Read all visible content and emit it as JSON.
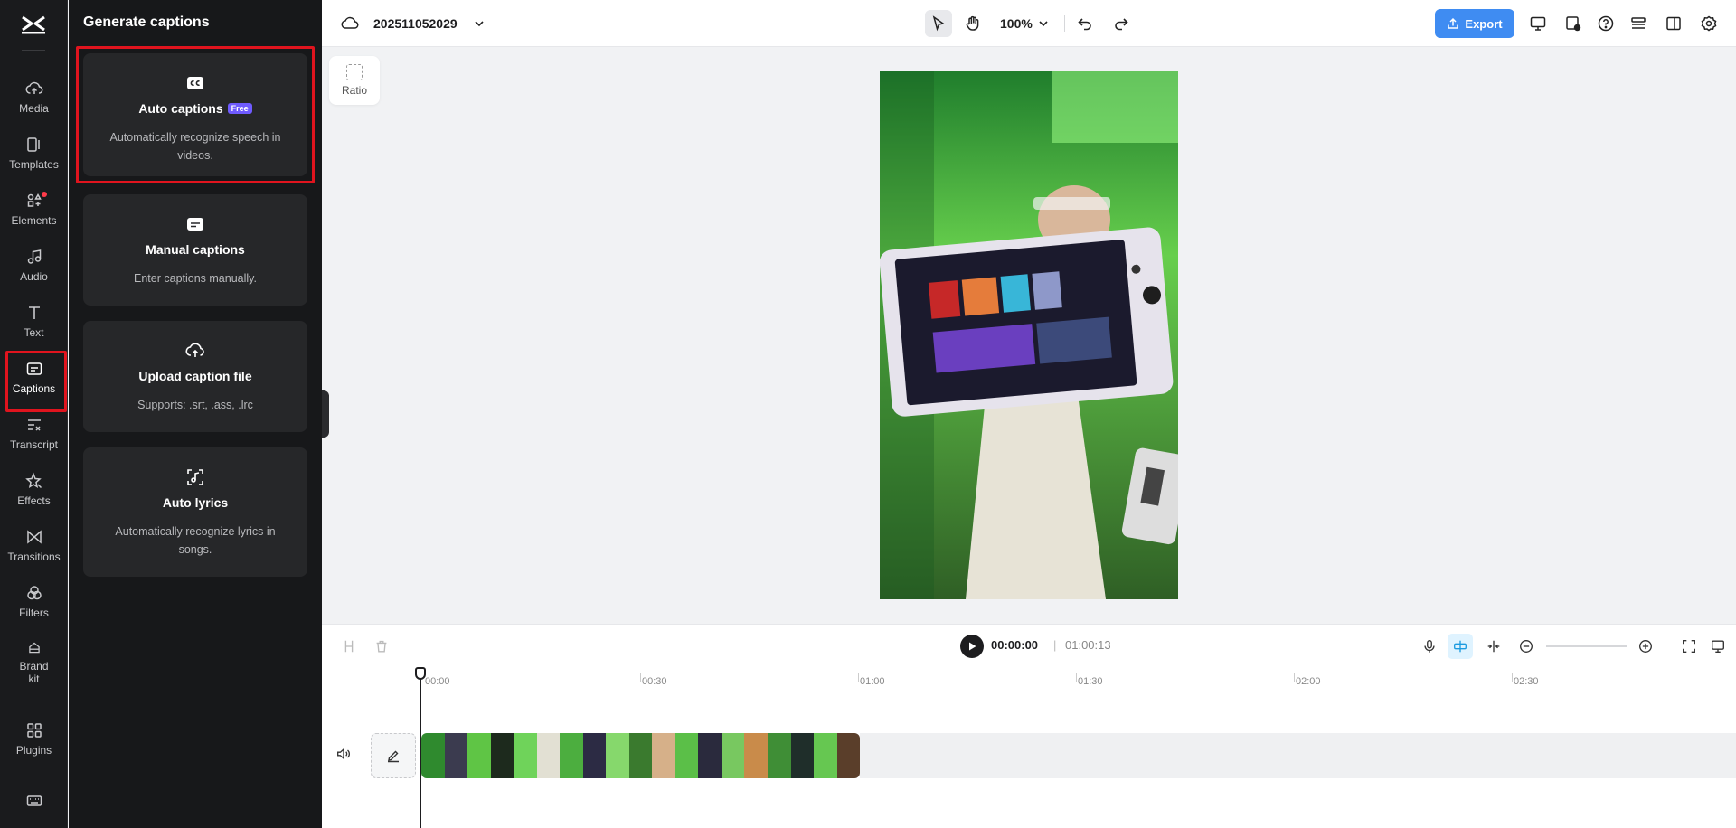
{
  "rail": {
    "items": [
      {
        "label": "Media",
        "icon": "cloud-upload-icon"
      },
      {
        "label": "Templates",
        "icon": "templates-icon"
      },
      {
        "label": "Elements",
        "icon": "elements-icon"
      },
      {
        "label": "Audio",
        "icon": "music-note-icon"
      },
      {
        "label": "Text",
        "icon": "text-icon"
      },
      {
        "label": "Captions",
        "icon": "captions-icon"
      },
      {
        "label": "Transcript",
        "icon": "transcript-icon"
      },
      {
        "label": "Effects",
        "icon": "effects-icon"
      },
      {
        "label": "Transitions",
        "icon": "transitions-icon"
      },
      {
        "label": "Filters",
        "icon": "filters-icon"
      },
      {
        "label": "Brand kit",
        "icon": "brand-kit-icon"
      },
      {
        "label": "Plugins",
        "icon": "plugins-icon"
      }
    ]
  },
  "panel": {
    "title": "Generate captions",
    "cards": [
      {
        "title": "Auto captions",
        "badge": "Free",
        "desc": "Automatically recognize speech in videos."
      },
      {
        "title": "Manual captions",
        "desc": "Enter captions manually."
      },
      {
        "title": "Upload caption file",
        "desc": "Supports: .srt, .ass, .lrc"
      },
      {
        "title": "Auto lyrics",
        "desc": "Automatically recognize lyrics in songs."
      }
    ]
  },
  "topbar": {
    "project_name": "202511052029",
    "zoom": "100%",
    "export_label": "Export"
  },
  "canvas": {
    "ratio_label": "Ratio"
  },
  "timeline": {
    "current_time": "00:00:00",
    "separator": "|",
    "duration": "01:00:13",
    "ruler": [
      "00:00",
      "00:30",
      "01:00",
      "01:30",
      "02:00",
      "02:30"
    ]
  },
  "colors": {
    "accent": "#3f8cf2",
    "highlight": "#e0141e",
    "badge": "#6f5bff"
  }
}
